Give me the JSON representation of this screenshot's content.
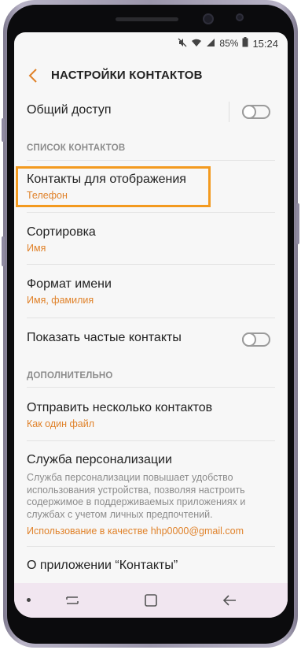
{
  "status_bar": {
    "battery": "85%",
    "time": "15:24",
    "icons": [
      "mute-icon",
      "wifi-icon",
      "signal-icon",
      "battery-icon"
    ]
  },
  "app_bar": {
    "title": "НАСТРОЙКИ КОНТАКТОВ",
    "back_icon": "chevron-left-icon"
  },
  "settings": {
    "shared_access": {
      "label": "Общий доступ",
      "toggle_on": false
    },
    "contact_list_header": "СПИСОК КОНТАКТОВ",
    "contacts_to_display": {
      "label": "Контакты для отображения",
      "value": "Телефон",
      "highlighted": true
    },
    "sorting": {
      "label": "Сортировка",
      "value": "Имя"
    },
    "name_format": {
      "label": "Формат имени",
      "value": "Имя, фамилия"
    },
    "frequent_contacts": {
      "label": "Показать частые контакты",
      "toggle_on": false
    },
    "additional_header": "ДОПОЛНИТЕЛЬНО",
    "send_multiple": {
      "label": "Отправить несколько контактов",
      "value": "Как один файл"
    },
    "personalization": {
      "label": "Служба персонализации",
      "description": "Служба персонализации повышает удобство использования устройства, позволяя настроить содержимое в поддерживаемых приложениях и службах с учетом личных предпочтений.",
      "account": "Использование в качестве hhp0000@gmail.com"
    },
    "about": {
      "label": "О приложении “Контакты”"
    }
  },
  "nav_bar": {
    "buttons": [
      "recents-icon",
      "home-icon",
      "back-icon"
    ]
  },
  "colors": {
    "accent": "#e0822a",
    "highlight_border": "#f39a1f",
    "nav_bar_bg": "#f1e6f0"
  }
}
